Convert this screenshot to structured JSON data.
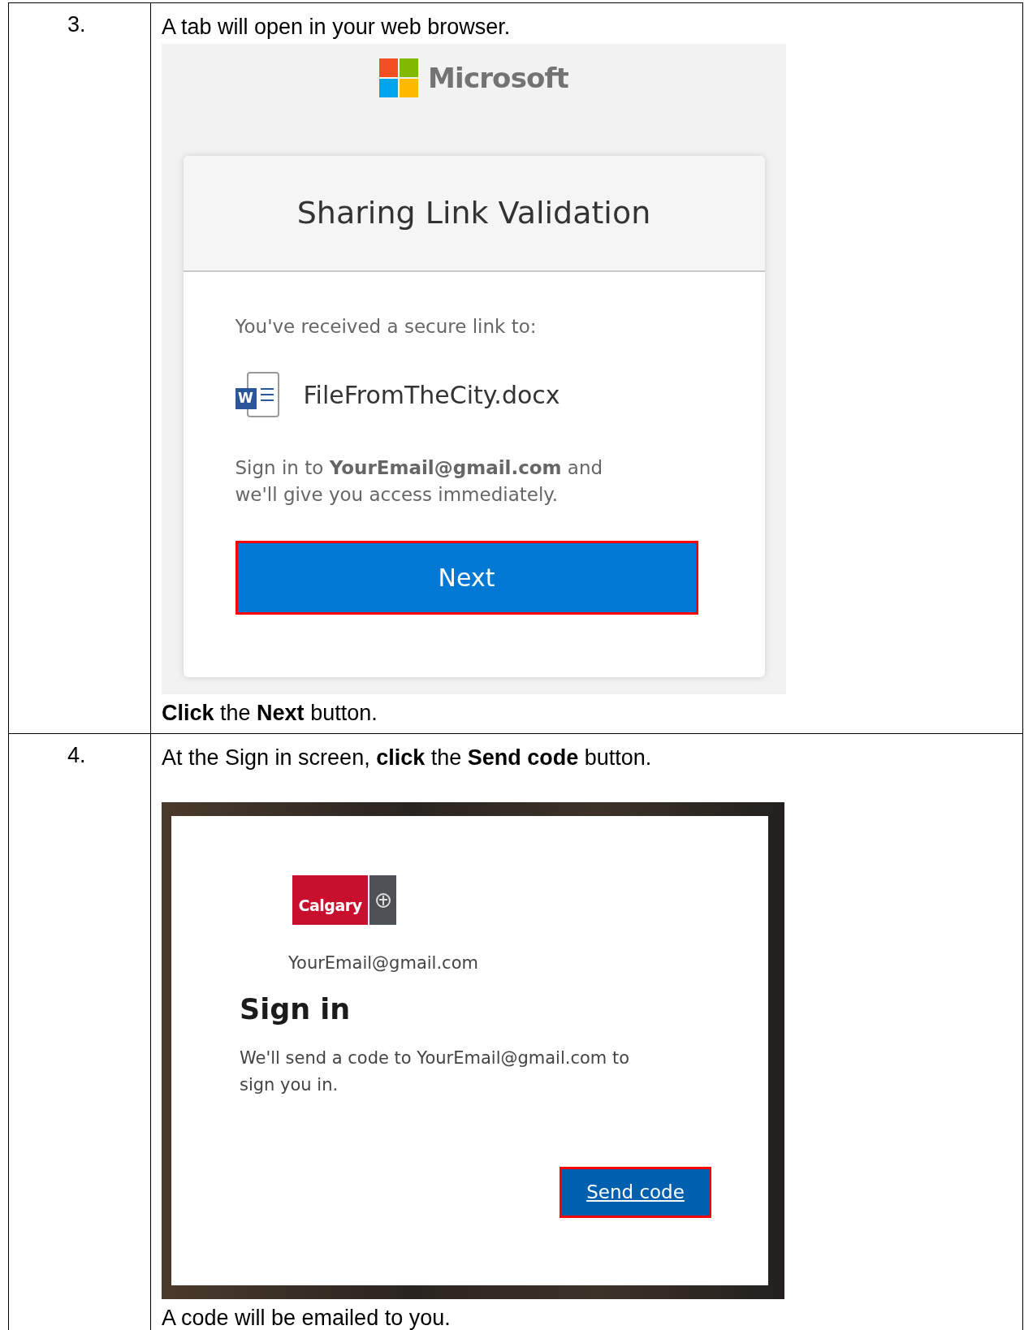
{
  "steps": [
    {
      "number": "3.",
      "instruction": "A tab will open in your web browser.",
      "screenshot": {
        "kind": "sharing",
        "brand": "Microsoft",
        "title": "Sharing Link Validation",
        "received": "You've received a secure link to:",
        "file_icon_letter": "W",
        "file_name": "FileFromTheCity.docx",
        "message": "Sign in to **YourEmail@gmail.com** and we'll give you access immediately.",
        "button": "Next",
        "highlighted": true
      },
      "note": "**Click** the **Next** button."
    },
    {
      "number": "4.",
      "instruction": "At the Sign in screen, **click** the **Send code** button.",
      "screenshot": {
        "kind": "signin",
        "logo_text": "Calgary",
        "email": "YourEmail@gmail.com",
        "title": "Sign in",
        "message": "We'll send a code to YourEmail@gmail.com to sign you in.",
        "button": "Send code",
        "highlighted": true
      },
      "note": "A code will be emailed to you."
    }
  ]
}
